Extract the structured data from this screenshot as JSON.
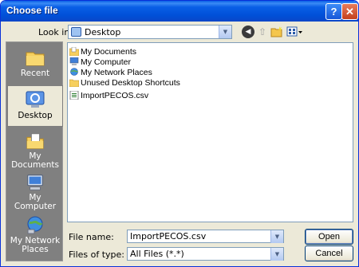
{
  "window": {
    "title": "Choose file"
  },
  "titlebar": {
    "help_glyph": "?",
    "close_glyph": "✕"
  },
  "lookin": {
    "label": "Look in:",
    "value": "Desktop",
    "icon": "desktop-icon"
  },
  "toolbar": {
    "back_icon": "back-arrow-icon",
    "up_icon": "up-folder-icon",
    "new_folder_icon": "new-folder-icon",
    "views_icon": "views-menu-icon"
  },
  "places": [
    {
      "label": "Recent",
      "icon": "recent-folder-icon",
      "selected": false
    },
    {
      "label": "Desktop",
      "icon": "desktop-icon",
      "selected": true
    },
    {
      "label": "My Documents",
      "icon": "my-documents-icon",
      "selected": false
    },
    {
      "label": "My Computer",
      "icon": "my-computer-icon",
      "selected": false
    },
    {
      "label": "My Network Places",
      "icon": "network-places-icon",
      "selected": false
    }
  ],
  "files": [
    {
      "name": "My Documents",
      "icon": "my-documents-icon"
    },
    {
      "name": "My Computer",
      "icon": "my-computer-icon"
    },
    {
      "name": "My Network Places",
      "icon": "network-places-icon"
    },
    {
      "name": "Unused Desktop Shortcuts",
      "icon": "folder-icon"
    },
    {
      "name": "ImportPECOS.csv",
      "icon": "csv-file-icon"
    }
  ],
  "filename": {
    "label": "File name:",
    "value": "ImportPECOS.csv"
  },
  "filetype": {
    "label": "Files of type:",
    "value": "All Files (*.*)"
  },
  "buttons": {
    "open": "Open",
    "cancel": "Cancel"
  },
  "colors": {
    "titlebar": "#0a5fe6",
    "places_bg": "#808080",
    "dialog_bg": "#ece9d8"
  }
}
